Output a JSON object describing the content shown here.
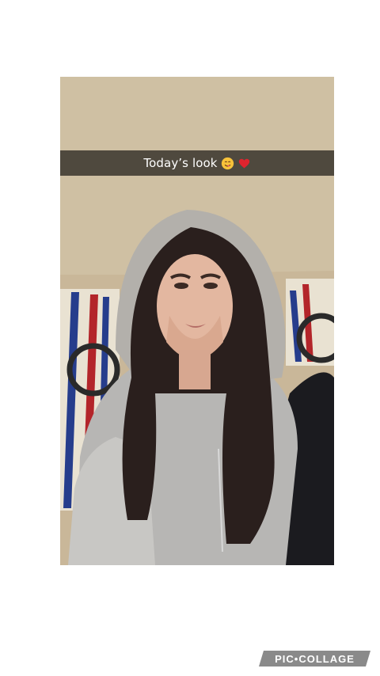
{
  "story": {
    "caption": "Today’s look",
    "caption_emojis": [
      "smiling-face-icon",
      "red-heart-icon"
    ],
    "photo_subject": "selfie-photo"
  },
  "watermark": {
    "label": "PIC•COLLAGE",
    "color": "#8a8a8a"
  },
  "colors": {
    "background": "#ffffff",
    "caption_bar": "#000000",
    "caption_text": "#ffffff",
    "heart": "#e0242e",
    "smiley": "#f7c23a"
  }
}
